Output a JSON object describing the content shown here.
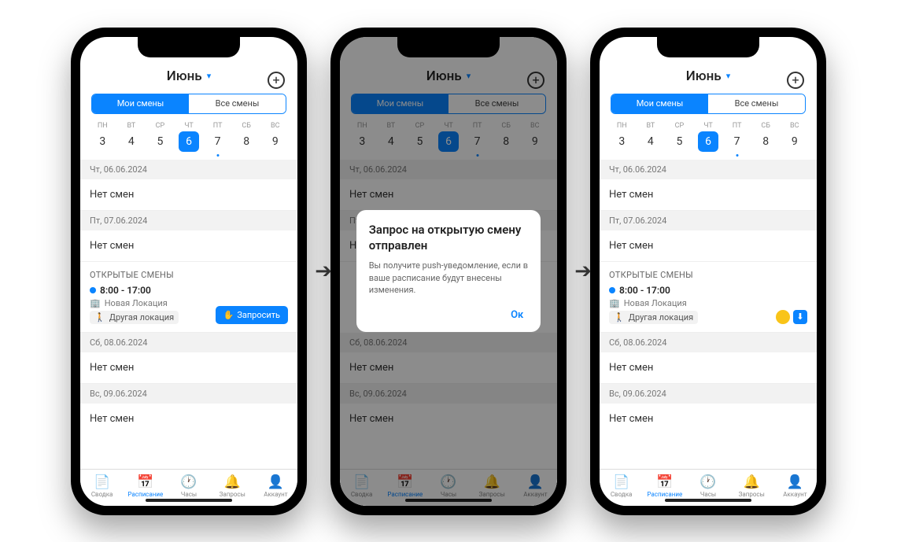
{
  "month_label": "Июнь",
  "segmented": {
    "my": "Мои смены",
    "all": "Все смены"
  },
  "weekdays": [
    {
      "label": "ПН",
      "num": "3"
    },
    {
      "label": "ВТ",
      "num": "4"
    },
    {
      "label": "СР",
      "num": "5"
    },
    {
      "label": "ЧТ",
      "num": "6",
      "selected": true
    },
    {
      "label": "ПТ",
      "num": "7",
      "dot": true
    },
    {
      "label": "СБ",
      "num": "8"
    },
    {
      "label": "ВС",
      "num": "9"
    }
  ],
  "dates": {
    "thu": "Чт, 06.06.2024",
    "fri": "Пт, 07.06.2024",
    "sat": "Сб, 08.06.2024",
    "sun": "Вс, 09.06.2024"
  },
  "no_shifts": "Нет смен",
  "open_shifts_title": "ОТКРЫТЫЕ СМЕНЫ",
  "shift": {
    "time": "8:00 - 17:00",
    "location1": "Новая Локация",
    "location2": "Другая локация"
  },
  "claim_label": "Запросить",
  "modal": {
    "title": "Запрос на открытую смену отправлен",
    "body": "Вы получите push-уведомление, если в ваше расписание будут внесены изменения.",
    "ok": "Ок"
  },
  "tabs": {
    "summary": "Сводка",
    "schedule": "Расписание",
    "hours": "Часы",
    "requests": "Запросы",
    "account": "Аккаунт"
  },
  "icons": {
    "building": "🏢",
    "walk": "🚶",
    "hand": "✋",
    "download": "⬇",
    "summary": "📄",
    "schedule": "📅",
    "hours": "🕐",
    "requests": "🔔",
    "account": "👤"
  }
}
